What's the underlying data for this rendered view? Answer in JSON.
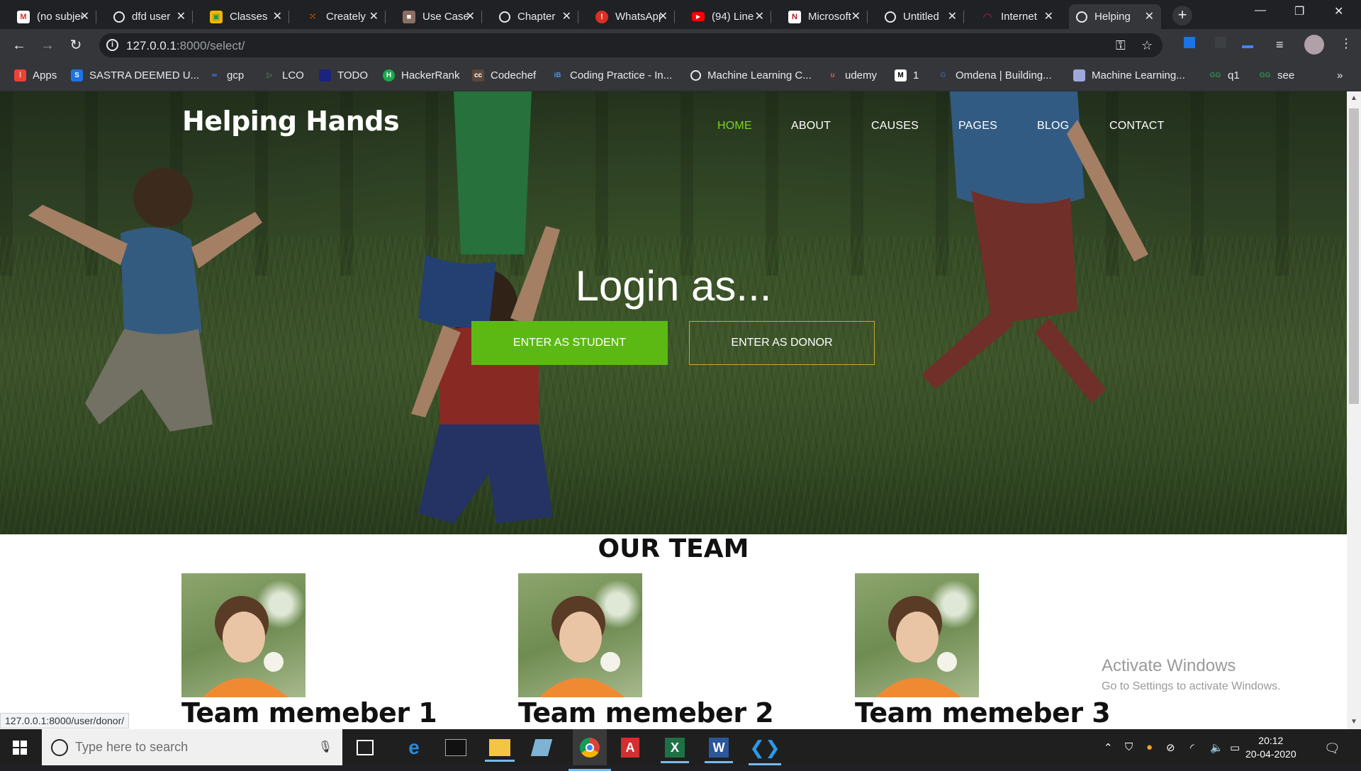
{
  "browser": {
    "tabs": [
      {
        "title": "(no subject)",
        "favicon": "gmail-icon",
        "color": "#d93025"
      },
      {
        "title": "dfd user",
        "favicon": "globe-icon",
        "color": "#e8eaed"
      },
      {
        "title": "Classes",
        "favicon": "classroom-icon",
        "color": "#f4b400"
      },
      {
        "title": "Creately",
        "favicon": "creately-icon",
        "color": "#ff6f00"
      },
      {
        "title": "Use Case",
        "favicon": "box-icon",
        "color": "#c0392b"
      },
      {
        "title": "Chapter",
        "favicon": "globe-icon",
        "color": "#e8eaed"
      },
      {
        "title": "WhatsApp",
        "favicon": "alert-icon",
        "color": "#d93025"
      },
      {
        "title": "(94) Line",
        "favicon": "youtube-icon",
        "color": "#ff0000"
      },
      {
        "title": "Microsoft",
        "favicon": "microsoft-n-icon",
        "color": "#b01e23"
      },
      {
        "title": "Untitled",
        "favicon": "globe-icon",
        "color": "#e8eaed"
      },
      {
        "title": "Internet",
        "favicon": "arc-icon",
        "color": "#c2185b"
      },
      {
        "title": "Helping",
        "favicon": "globe-icon",
        "color": "#e8eaed",
        "active": true
      }
    ],
    "new_tab_label": "+",
    "url_host": "127.0.0.1",
    "url_path": ":8000/select/",
    "bookmarks": [
      {
        "label": "Apps",
        "icon": "apps-grid-icon",
        "color": "#ea4335"
      },
      {
        "label": "SASTRA DEEMED U...",
        "icon": "sastra-icon",
        "color": "#1a73e8"
      },
      {
        "label": "gcp",
        "icon": "cloud-link-icon",
        "color": "#4285f4"
      },
      {
        "label": "LCO",
        "icon": "lco-icon",
        "color": "#6aa84f"
      },
      {
        "label": "TODO",
        "icon": "todo-icon",
        "color": "#1a237e"
      },
      {
        "label": "HackerRank",
        "icon": "hackerrank-icon",
        "color": "#1ba94c"
      },
      {
        "label": "Codechef",
        "icon": "codechef-icon",
        "color": "#5b4638"
      },
      {
        "label": "Coding Practice - In...",
        "icon": "ib-icon",
        "color": "#4a90e2"
      },
      {
        "label": "Machine Learning C...",
        "icon": "globe-icon",
        "color": "#e8eaed"
      },
      {
        "label": "udemy",
        "icon": "udemy-icon",
        "color": "#ec5252"
      },
      {
        "label": "1",
        "icon": "medium-icon",
        "color": "#ffffff"
      },
      {
        "label": "Omdena | Building...",
        "icon": "omdena-icon",
        "color": "#3b5998"
      },
      {
        "label": "Machine Learning...",
        "icon": "ml-icon",
        "color": "#9fa8da"
      },
      {
        "label": "q1",
        "icon": "gfg-icon",
        "color": "#2f8d46"
      },
      {
        "label": "see",
        "icon": "gfg-icon",
        "color": "#2f8d46"
      }
    ],
    "bookmarks_overflow": "»",
    "status_url": "127.0.0.1:8000/user/donor/"
  },
  "site": {
    "brand": "Helping Hands",
    "nav": [
      "HOME",
      "ABOUT",
      "CAUSES",
      "PAGES",
      "BLOG",
      "CONTACT"
    ],
    "active_nav": "HOME",
    "accent": "#7ed321",
    "hero_title": "Login as...",
    "btn_student": "ENTER AS STUDENT",
    "btn_donor": "ENTER AS DONOR",
    "team_title": "OUR TEAM",
    "team": [
      {
        "name": "Team memeber 1"
      },
      {
        "name": "Team memeber 2"
      },
      {
        "name": "Team memeber 3"
      }
    ]
  },
  "watermark": {
    "line1": "Activate Windows",
    "line2": "Go to Settings to activate Windows."
  },
  "taskbar": {
    "search_placeholder": "Type here to search",
    "apps": [
      "task-view-icon",
      "edge-icon",
      "terminal-icon",
      "file-explorer-icon",
      "notes-icon",
      "chrome-icon",
      "acrobat-icon",
      "excel-icon",
      "word-icon",
      "vscode-icon"
    ],
    "time": "20:12",
    "date": "20-04-2020"
  }
}
